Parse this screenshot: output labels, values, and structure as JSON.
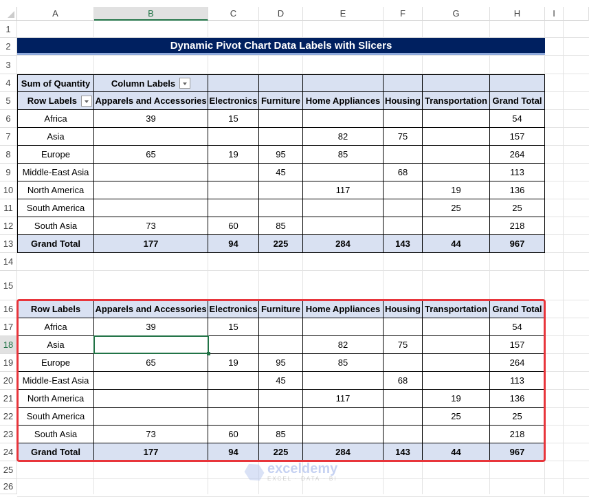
{
  "columns": [
    "A",
    "B",
    "C",
    "D",
    "E",
    "F",
    "G",
    "H",
    "I"
  ],
  "selected_column": "B",
  "selected_row": 18,
  "title": "Dynamic Pivot Chart Data Labels with Slicers",
  "pivot": {
    "corner_label": "Sum of Quantity",
    "column_labels": "Column Labels",
    "row_labels": "Row Labels",
    "headers": [
      "Apparels and Accessories",
      "Electronics",
      "Furniture",
      "Home Appliances",
      "Housing",
      "Transportation",
      "Grand Total"
    ],
    "rows": [
      {
        "label": "Africa",
        "values": [
          "39",
          "15",
          "",
          "",
          "",
          "",
          "54"
        ]
      },
      {
        "label": "Asia",
        "values": [
          "",
          "",
          "",
          "82",
          "75",
          "",
          "157"
        ]
      },
      {
        "label": "Europe",
        "values": [
          "65",
          "19",
          "95",
          "85",
          "",
          "",
          "264"
        ]
      },
      {
        "label": "Middle-East Asia",
        "values": [
          "",
          "",
          "45",
          "",
          "68",
          "",
          "113"
        ]
      },
      {
        "label": "North America",
        "values": [
          "",
          "",
          "",
          "117",
          "",
          "19",
          "136"
        ]
      },
      {
        "label": "South America",
        "values": [
          "",
          "",
          "",
          "",
          "",
          "25",
          "25"
        ]
      },
      {
        "label": "South Asia",
        "values": [
          "73",
          "60",
          "85",
          "",
          "",
          "",
          "218"
        ]
      }
    ],
    "total": {
      "label": "Grand Total",
      "values": [
        "177",
        "94",
        "225",
        "284",
        "143",
        "44",
        "967"
      ]
    }
  },
  "copy": {
    "row_labels": "Row Labels",
    "headers": [
      "Apparels and Accessories",
      "Electronics",
      "Furniture",
      "Home Appliances",
      "Housing",
      "Transportation",
      "Grand Total"
    ],
    "rows": [
      {
        "label": "Africa",
        "values": [
          "39",
          "15",
          "",
          "",
          "",
          "",
          "54"
        ]
      },
      {
        "label": "Asia",
        "values": [
          "",
          "",
          "",
          "82",
          "75",
          "",
          "157"
        ]
      },
      {
        "label": "Europe",
        "values": [
          "65",
          "19",
          "95",
          "85",
          "",
          "",
          "264"
        ]
      },
      {
        "label": "Middle-East Asia",
        "values": [
          "",
          "",
          "45",
          "",
          "68",
          "",
          "113"
        ]
      },
      {
        "label": "North America",
        "values": [
          "",
          "",
          "",
          "117",
          "",
          "19",
          "136"
        ]
      },
      {
        "label": "South America",
        "values": [
          "",
          "",
          "",
          "",
          "",
          "25",
          "25"
        ]
      },
      {
        "label": "South Asia",
        "values": [
          "73",
          "60",
          "85",
          "",
          "",
          "",
          "218"
        ]
      }
    ],
    "total": {
      "label": "Grand Total",
      "values": [
        "177",
        "94",
        "225",
        "284",
        "143",
        "44",
        "967"
      ]
    }
  },
  "watermark": {
    "name": "exceldemy",
    "tagline": "EXCEL · DATA · BI"
  }
}
